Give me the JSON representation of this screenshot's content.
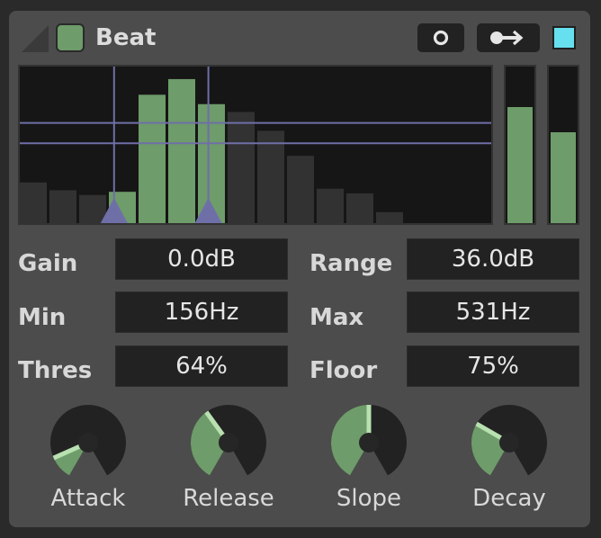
{
  "device": {
    "title": "Beat",
    "power_on": true,
    "accent_color": "#6e9c6a",
    "swatch_color": "#66e0ee"
  },
  "header": {
    "icons": [
      "fold-triangle-icon",
      "record-circle-icon",
      "route-arrow-icon"
    ]
  },
  "spectrum": {
    "bar_heights": [
      0.26,
      0.21,
      0.18,
      0.2,
      0.82,
      0.92,
      0.76,
      0.71,
      0.59,
      0.43,
      0.22,
      0.19,
      0.07
    ],
    "band_active": [
      false,
      false,
      false,
      true,
      true,
      true,
      true,
      false,
      false,
      false,
      false,
      false,
      false
    ],
    "min_marker_fraction": 0.2,
    "max_marker_fraction": 0.4,
    "threshold_fraction": 0.64,
    "floor_fraction": 0.51
  },
  "meters": {
    "left_level": 0.74,
    "right_level": 0.58
  },
  "params": {
    "gain": {
      "label": "Gain",
      "value": "0.0dB"
    },
    "range": {
      "label": "Range",
      "value": "36.0dB"
    },
    "min": {
      "label": "Min",
      "value": "156Hz"
    },
    "max": {
      "label": "Max",
      "value": "531Hz"
    },
    "thres": {
      "label": "Thres",
      "value": "64%"
    },
    "floor": {
      "label": "Floor",
      "value": "75%"
    }
  },
  "knobs": {
    "attack": {
      "label": "Attack",
      "level": 0.12
    },
    "release": {
      "label": "Release",
      "level": 0.38
    },
    "slope": {
      "label": "Slope",
      "level": 0.5
    },
    "decay": {
      "label": "Decay",
      "level": 0.3
    }
  }
}
